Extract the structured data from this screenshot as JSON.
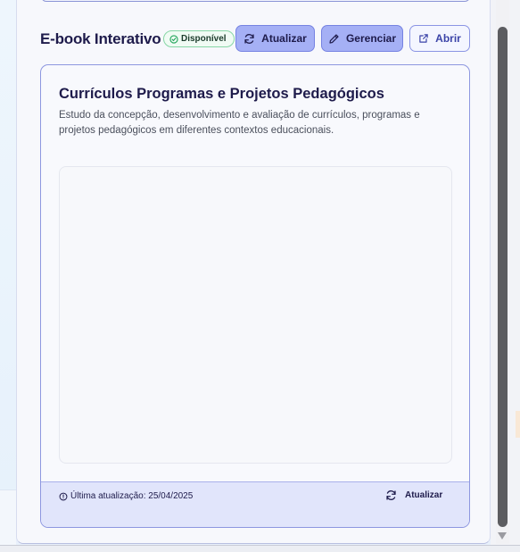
{
  "header": {
    "title": "E-book Interativo",
    "status_badge": "Disponível",
    "atualizar_label": "Atualizar",
    "gerenciar_label": "Gerenciar",
    "abrir_label": "Abrir"
  },
  "card": {
    "title": "Currículos Programas e Projetos Pedagógicos",
    "description": "Estudo da concepção, desenvolvimento e avaliação de currículos, programas e projetos pedagógicos em diferentes contextos educacionais.",
    "footer": {
      "last_update": "Última atualização: 25/04/2025",
      "refresh_label": "Atualizar"
    }
  },
  "colors": {
    "accent": "#a5b0f5",
    "accent_border": "#7683e2",
    "text_dark": "#1e1b4b",
    "badge_green": "#22a55a"
  },
  "icons": [
    "check-circle-icon",
    "refresh-icon",
    "pencil-icon",
    "external-link-icon",
    "clock-icon"
  ]
}
